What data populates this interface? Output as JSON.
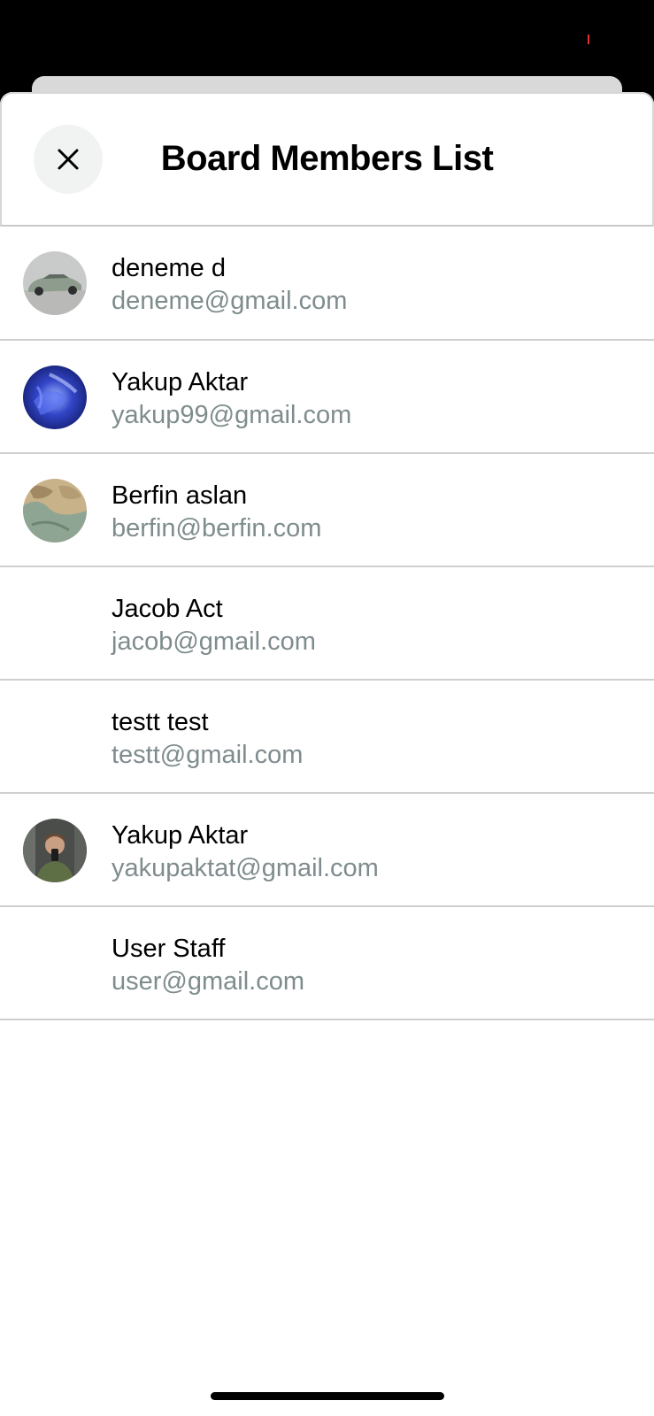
{
  "header": {
    "title": "Board Members List",
    "close_icon": "close-icon"
  },
  "members": [
    {
      "name": "deneme d",
      "email": "deneme@gmail.com",
      "avatar": "car-photo"
    },
    {
      "name": "Yakup Aktar",
      "email": "yakup99@gmail.com",
      "avatar": "blue-abstract-photo"
    },
    {
      "name": "Berfin aslan",
      "email": "berfin@berfin.com",
      "avatar": "map-photo"
    },
    {
      "name": "Jacob Act",
      "email": "jacob@gmail.com",
      "avatar": ""
    },
    {
      "name": "testt test",
      "email": "testt@gmail.com",
      "avatar": ""
    },
    {
      "name": "Yakup Aktar",
      "email": "yakupaktat@gmail.com",
      "avatar": "selfie-photo"
    },
    {
      "name": "User Staff",
      "email": "user@gmail.com",
      "avatar": ""
    }
  ],
  "colors": {
    "email_text": "#7f8c8d",
    "divider": "#cfcfcf",
    "close_button_bg": "#f1f3f3"
  }
}
